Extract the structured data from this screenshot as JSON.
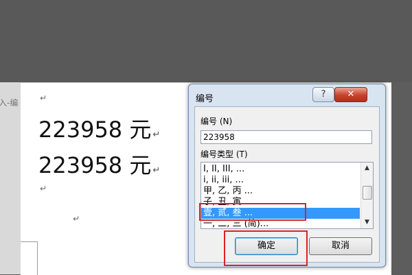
{
  "background": {
    "left_label": "入-编"
  },
  "document": {
    "lines": [
      "223958 元",
      "223958 元"
    ],
    "para_mark": "↵"
  },
  "dialog": {
    "title": "编号",
    "help_button": "?",
    "close_button": "✕",
    "number_label": "编号 (N)",
    "number_value": "223958",
    "type_label": "编号类型 (T)",
    "types": [
      "I, II, III, ...",
      "i, ii, iii, ...",
      "甲, 乙, 丙 ...",
      "子, 丑, 寅 ...",
      "壹, 贰, 叁 ...",
      "一, 二, 三 (简)..."
    ],
    "selected_index": 4,
    "ok_button": "确定",
    "cancel_button": "取消"
  },
  "colors": {
    "selection": "#3399ff",
    "highlight_box": "#e02020"
  }
}
